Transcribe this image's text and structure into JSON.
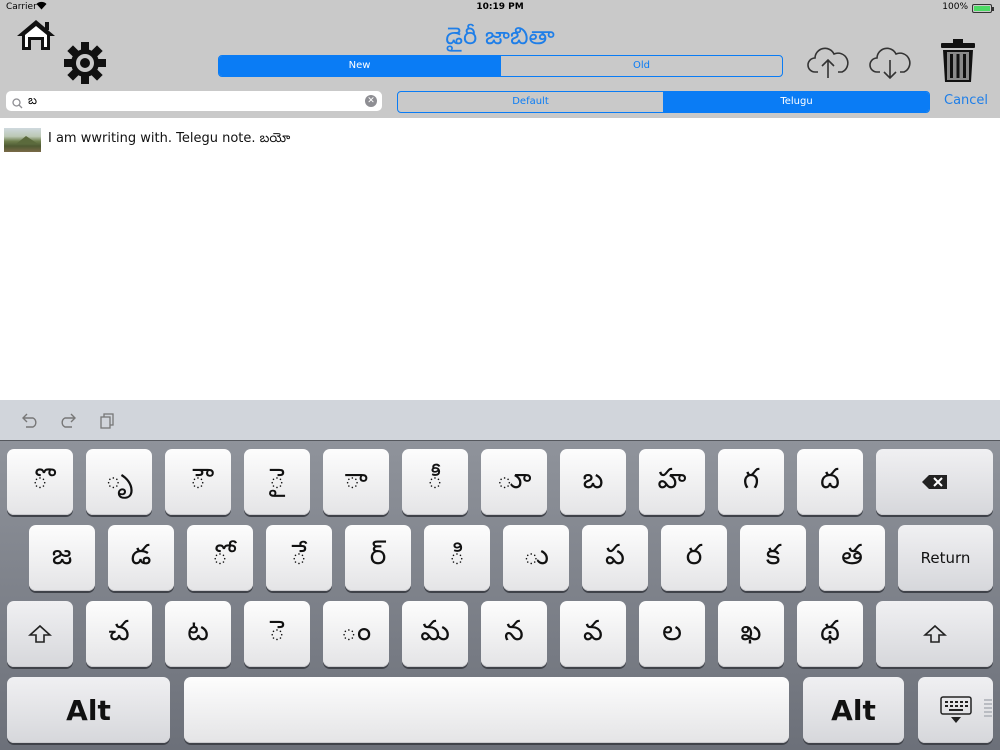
{
  "status_bar": {
    "carrier": "Carrier",
    "wifi_icon": "wifi-icon",
    "time": "10:19 PM",
    "battery": "100%",
    "battery_icon": "battery-icon"
  },
  "header": {
    "title": "డైరీ జాబితా",
    "home_icon": "home-icon",
    "settings_icon": "gear-icon",
    "upload_icon": "cloud-upload-icon",
    "download_icon": "cloud-download-icon",
    "delete_icon": "trash-icon",
    "sort_segments": [
      {
        "label": "New",
        "selected": true
      },
      {
        "label": "Old",
        "selected": false
      }
    ]
  },
  "search": {
    "value": "బ",
    "search_icon": "search-icon",
    "clear_icon": "clear-icon",
    "lang_segments": [
      {
        "label": "Default",
        "selected": false
      },
      {
        "label": "Telugu",
        "selected": true
      }
    ],
    "cancel_label": "Cancel"
  },
  "notes": [
    {
      "text": "I am wwriting with. Telegu note. బయో",
      "thumbnail": "landscape-thumbnail"
    }
  ],
  "keyboard": {
    "toolbar": [
      "undo-icon",
      "redo-icon",
      "paste-icon"
    ],
    "row1": [
      "ొ",
      "ృ",
      "ౌ",
      "ై",
      "ా",
      "ీ",
      "ూ",
      "బ",
      "హ",
      "గ",
      "ద"
    ],
    "row2": [
      "జ",
      "డ",
      "ో",
      "ే",
      "ర్",
      "ి",
      "ు",
      "ప",
      "ర",
      "క",
      "త"
    ],
    "row3": [
      "చ",
      "ట",
      "ె",
      "ం",
      "మ",
      "న",
      "వ",
      "ల",
      "ఖ",
      "థ"
    ],
    "return_label": "Return",
    "alt_label": "Alt",
    "backspace_icon": "backspace-icon",
    "shift_icon": "shift-icon",
    "dismiss_icon": "keyboard-dismiss-icon"
  },
  "colors": {
    "accent": "#0a7cf5",
    "title": "#1e7ee8",
    "bar_background": "#c9c9c9",
    "keyboard_background": "#7d818a"
  }
}
